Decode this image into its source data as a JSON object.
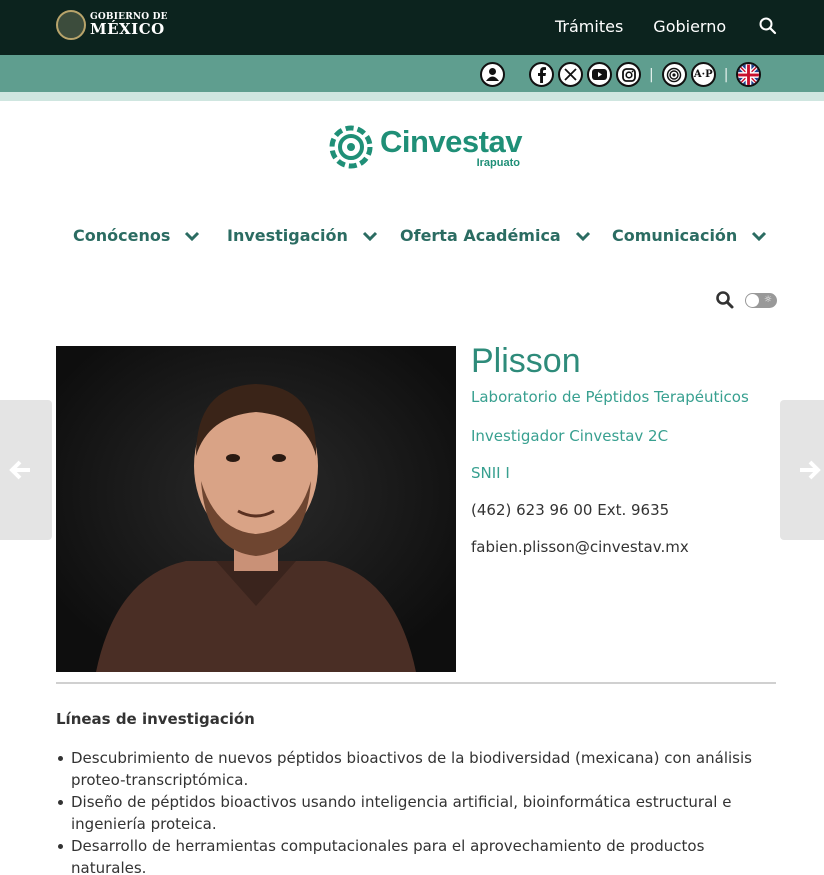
{
  "gov_bar": {
    "logo_line1": "GOBIERNO DE",
    "logo_line2": "MÉXICO",
    "links": [
      "Trámites",
      "Gobierno"
    ],
    "search_icon": "search-icon"
  },
  "social": {
    "icons": [
      "user-icon",
      "facebook-icon",
      "x-icon",
      "youtube-icon",
      "instagram-icon",
      "transparency-icon",
      "ap-icon",
      "uk-flag-icon"
    ],
    "ap_label": "A·P",
    "separator": "|"
  },
  "logo": {
    "name": "Cinvestav",
    "campus": "Irapuato",
    "color": "#1f8f77"
  },
  "nav": {
    "items": [
      "Conócenos",
      "Investigación",
      "Oferta Académica",
      "Comunicación"
    ]
  },
  "profile": {
    "name_tail": "Plisson",
    "lab": "Laboratorio de Péptidos Terapéuticos",
    "rank": "Investigador Cinvestav 2C",
    "snii": "SNII I",
    "phone": "(462) 623 96 00 Ext. 9635",
    "email": "fabien.plisson@cinvestav.mx"
  },
  "research": {
    "title": "Líneas de investigación",
    "items": [
      "Descubrimiento de nuevos péptidos bioactivos de la biodiversidad (mexicana) con análisis proteo-transcriptómica.",
      "Diseño de péptidos bioactivos usando inteligencia artificial, bioinformática estructural e ingeniería proteica.",
      "Desarrollo de herramientas computacionales para el aprovechamiento de productos naturales."
    ]
  },
  "colors": {
    "gov_bar": "#0c231e",
    "social_bar": "#5f9e8f",
    "accent": "#2e8b7a",
    "nav_text": "#2b6c62"
  }
}
